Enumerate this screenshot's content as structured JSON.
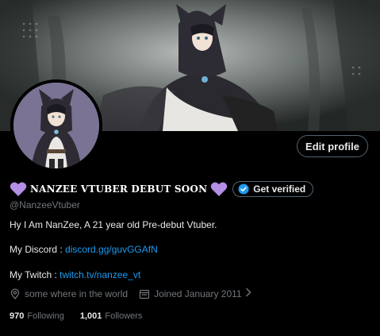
{
  "profile": {
    "display_name": "NANZEE VTUBER DEBUT SOON",
    "handle": "@NanzeeVtuber",
    "edit_label": "Edit profile",
    "verify_label": "Get verified",
    "bio": {
      "line1": "Hy I Am NanZee, A 21 year old Pre-debut Vtuber.",
      "discord_prefix": "My Discord : ",
      "discord_link": "discord.gg/guvGGAfN",
      "twitch_prefix": "My Twitch : ",
      "twitch_link": "twitch.tv/nanzee_vt"
    },
    "location": "some where in the world",
    "joined": "Joined January 2011",
    "following_count": "970",
    "following_label": "Following",
    "followers_count": "1,001",
    "followers_label": "Followers"
  },
  "icons": {
    "heart": "purple-heart-icon",
    "verified": "verified-badge-icon",
    "location": "location-pin-icon",
    "calendar": "calendar-icon",
    "chevron": "chevron-right-icon"
  },
  "colors": {
    "background": "#000000",
    "text": "#e7e9ea",
    "muted": "#71767b",
    "link": "#1d9bf0",
    "heart": "#b58ee6"
  }
}
